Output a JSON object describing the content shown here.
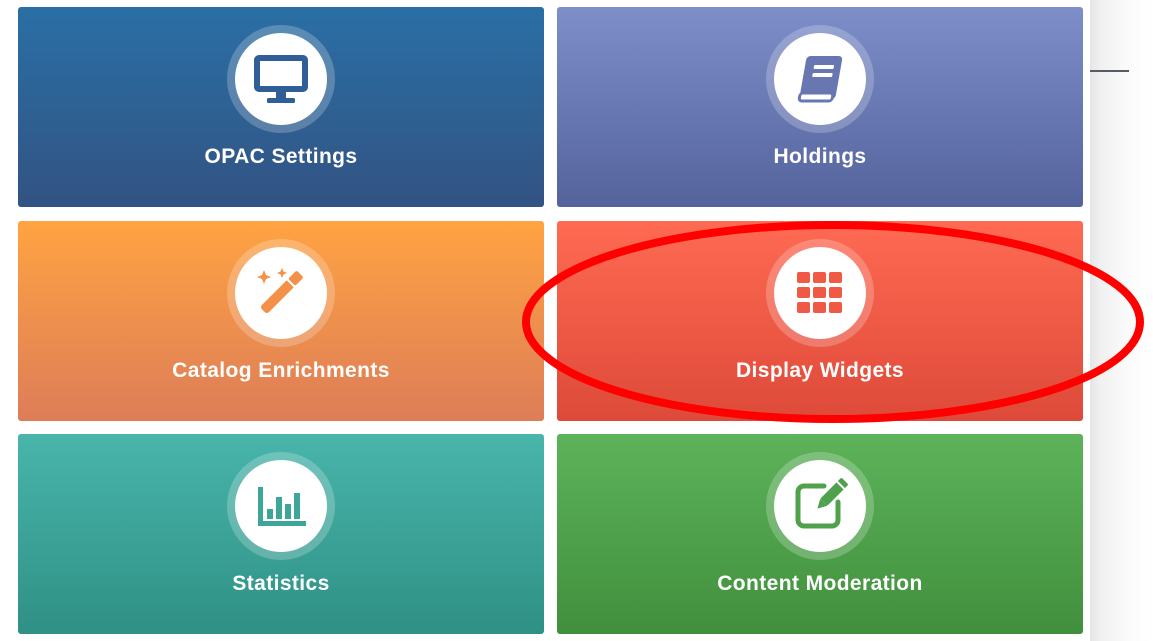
{
  "tiles": [
    {
      "id": "opac",
      "label": "OPAC Settings",
      "icon": "monitor-icon",
      "color": "#2f5f96"
    },
    {
      "id": "holdings",
      "label": "Holdings",
      "icon": "book-icon",
      "color": "#6877b2"
    },
    {
      "id": "catalog",
      "label": "Catalog Enrichments",
      "icon": "magic-wand-icon",
      "color": "#f39148"
    },
    {
      "id": "display",
      "label": "Display Widgets",
      "icon": "grid-icon",
      "color": "#f05a45"
    },
    {
      "id": "stats",
      "label": "Statistics",
      "icon": "bar-chart-icon",
      "color": "#3ca69b"
    },
    {
      "id": "content",
      "label": "Content Moderation",
      "icon": "edit-icon",
      "color": "#4fa24b"
    }
  ],
  "highlight": {
    "target": "Display Widgets",
    "color": "#ff0000"
  }
}
